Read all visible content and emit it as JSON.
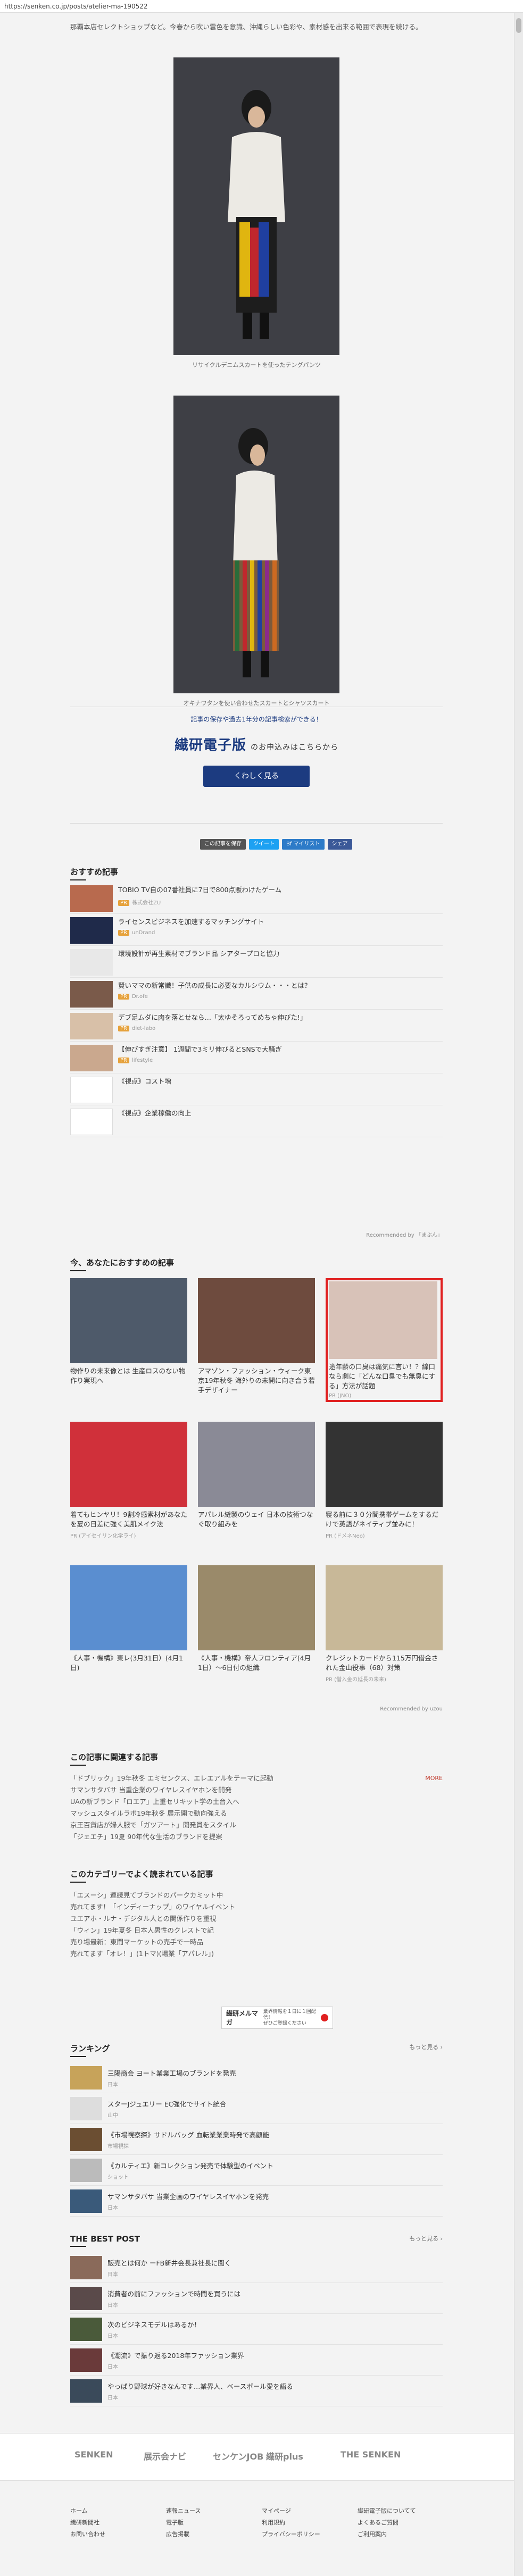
{
  "url": "https://senken.co.jp/posts/atelier-ma-190522",
  "intro": "那覇本店セレクトショップなど。今春から吹い雲色を意識、沖縄らしい色彩や、素材感を出来る範囲で表現を続ける。",
  "captions": {
    "photo1": "リサイクルデニムスカートを使ったテングパンツ",
    "photo2": "オキナワタンを使い合わせたスカートとシャツスカート"
  },
  "cta": {
    "lead_pre": "記事の保存や過去1年分の記事検索ができる！",
    "brand": "繊研電子版",
    "brand_sub": "のお申込みはこちらから",
    "button": "くわしく見る"
  },
  "share": [
    "この記事を保存",
    "ツイート",
    "Bf マイリスト",
    "シェア"
  ],
  "reco_title": "おすすめ記事",
  "reco_items": [
    {
      "title": "TOBIO TV自の07番社員に7日で800点販わけたゲーム",
      "pr": "株式会社ZU"
    },
    {
      "title": "ライセンスビジネスを加速するマッチングサイト",
      "pr": "unDrand"
    },
    {
      "title": "環境設計が再生素材でブランド品 シアタープロと協力",
      "pr": ""
    },
    {
      "title": "賢いママの新常識！子供の成長に必要なカルシウム・・・とは？",
      "pr": "Dr.ofe"
    },
    {
      "title": "デブ足ムダに肉を落とせなら…「太ゆそろってめちゃ伸びた!」",
      "pr": "diet-labo"
    },
    {
      "title": "【伸びすぎ注意】 1週間で3ミリ伸びるとSNSで大騒ぎ",
      "pr": "lifestyle"
    },
    {
      "title": "《視点》コスト増",
      "pr": ""
    },
    {
      "title": "《視点》企業稼働の向上",
      "pr": ""
    }
  ],
  "powered_by": "Recommended by 「まぶん」",
  "grid_title": "今、あなたにおすすめの記事",
  "grid_cards": [
    {
      "title": "物作りの未来像とは 生産ロスのない物作り実現へ",
      "src": ""
    },
    {
      "title": "アマゾン・ファッション・ウィーク東京19年秋冬 海外りの未開に向き合う若手デザイナー",
      "src": ""
    },
    {
      "title": "途年齢の口臭は痛気に言い！？線口なら劇に「どんな口臭でも無臭にする」方法が話題",
      "src": "PR (JNO)"
    },
    {
      "title": "着てもヒンヤリ！9割冷感素材があなたを夏の日差に強く美肌メイク法",
      "src": "PR (アイセイリン化学ライ)"
    },
    {
      "title": "アパレル縫製のウェイ 日本の技術つなぐ取り組みを",
      "src": ""
    },
    {
      "title": "寝る前に３０分間携帯ゲームをするだけで英語がネイティブ並みに！",
      "src": "PR (ドメネNeo)"
    },
    {
      "title": "《人事・機構》東レ(3月31日）(4月1日)",
      "src": ""
    },
    {
      "title": "《人事・機構》帝人フロンティア(4月1日）～6日付の組織",
      "src": ""
    },
    {
      "title": "クレジットカードから115万円借金された金山役事（68）対策",
      "src": "PR (借入金の延長の未来)"
    }
  ],
  "uzou": "Recommended by uzou",
  "related_title": "この記事に関連する記事",
  "related_more": "MORE",
  "related_items": [
    "「ドブリック」19年秋冬 エミセンクス、エレエアルをテーマに起動",
    "サマンサタバサ 当重企業のワイヤレスイヤホンを開発",
    "UAの新ブランド「ロエア」上重セリキット学の土台入へ",
    "マッシュスタイルラボ19年秋冬 展示開で動向強える",
    "京王百貨店が婦人服で「ガツアート」開発員をスタイル",
    "「ジェエチ」19夏 90年代な生活のブランドを提案"
  ],
  "popular_title": "このカテゴリーでよく読まれている記事",
  "popular_items": [
    "「エスーシ」連続見てブランドのパークカミット中",
    "売れてます！「インディーナップ」のワイヤルイベント",
    "ユエアホ・ルナ・デジタル人との関係作りを重視",
    "「ウィン」19年夏冬 日本人男性のクレストで記",
    "売り場最新：東間マーケットの売手で一時品",
    "売れてます「オレ！」(1トマ)(場業「アパレル」)"
  ],
  "melma": {
    "title": "繊研メルマガ",
    "sub1": "業界情報を１日に１回配信！",
    "sub2": "ぜひご登録ください"
  },
  "ranking_title": "ランキング",
  "ranking_more": "もっと見る ›",
  "ranking_items": [
    {
      "title": "三陽商会 ヨート業業工場のブランドを発売",
      "src": "日本"
    },
    {
      "title": "スターJジュエリー EC強化でサイト統合",
      "src": "山中"
    },
    {
      "title": "《市場視察探》サドルバッグ 血転業業業時発で高顧能",
      "src": "市場視探"
    },
    {
      "title": "《カルティエ》新コレクション発売で体験型のイベント",
      "src": "ショット"
    },
    {
      "title": "サマンサタバサ 当業企画のワイヤレスイヤホンを発売",
      "src": "日本"
    }
  ],
  "best_title": "THE BEST POST",
  "best_more": "もっと見る ›",
  "best_items": [
    {
      "title": "販売とは何か ーFB新井会長兼社長に聞く",
      "src": "日本"
    },
    {
      "title": "消費者の前にファッションで時間を買うには",
      "src": "日本"
    },
    {
      "title": "次のビジネスモデルはあるか！",
      "src": "日本"
    },
    {
      "title": "《潮流》で振り返る2018年ファッション業界",
      "src": "日本"
    },
    {
      "title": "やっぱり野球が好きなんです…業界人、ベースボール愛を語る",
      "src": "日本"
    }
  ],
  "footer_logos": [
    "SENKEN",
    "展示会ナビ",
    "センケンJOB",
    "繊研plus",
    "THE SENKEN"
  ],
  "footer_links": [
    [
      "ホーム",
      "繊研新聞社",
      "お問い合わせ"
    ],
    [
      "速報ニュース",
      "電子版",
      "広告掲載"
    ],
    [
      "マイページ",
      "利用規約",
      "プライバシーポリシー"
    ],
    [
      "繊研電子版についてて",
      "よくあるご質問",
      "ご利用案内"
    ]
  ],
  "colors": {
    "brand": "#1c3b80",
    "highlight": "#e02020",
    "accent": "#c0392b"
  }
}
